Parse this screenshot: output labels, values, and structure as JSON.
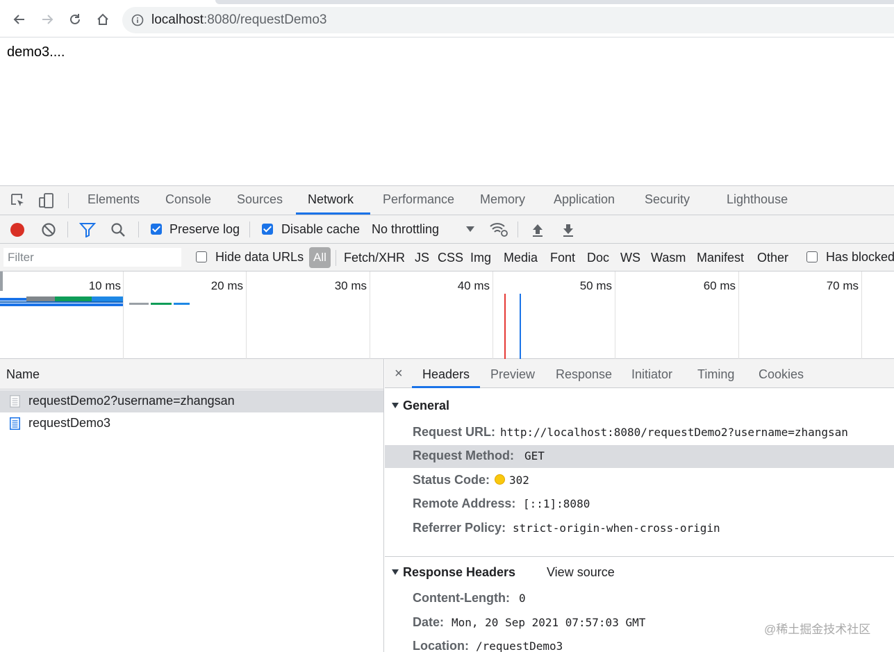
{
  "browser": {
    "url_host": "localhost",
    "url_path": ":8080/requestDemo3"
  },
  "page": {
    "body_text": "demo3...."
  },
  "devtools": {
    "tabs": [
      {
        "label": "Elements"
      },
      {
        "label": "Console"
      },
      {
        "label": "Sources"
      },
      {
        "label": "Network"
      },
      {
        "label": "Performance"
      },
      {
        "label": "Memory"
      },
      {
        "label": "Application"
      },
      {
        "label": "Security"
      },
      {
        "label": "Lighthouse"
      }
    ],
    "active_tab": "Network",
    "toolbar": {
      "preserve_log_label": "Preserve log",
      "preserve_log_checked": true,
      "disable_cache_label": "Disable cache",
      "disable_cache_checked": true,
      "throttling": "No throttling"
    },
    "filterbar": {
      "filter_placeholder": "Filter",
      "hide_data_urls_label": "Hide data URLs",
      "all_label": "All",
      "types": [
        "Fetch/XHR",
        "JS",
        "CSS",
        "Img",
        "Media",
        "Font",
        "Doc",
        "WS",
        "Wasm",
        "Manifest",
        "Other"
      ],
      "has_blocked_label": "Has blocked"
    },
    "overview": {
      "ticks": [
        "10 ms",
        "20 ms",
        "30 ms",
        "40 ms",
        "50 ms",
        "60 ms",
        "70 ms"
      ]
    },
    "requests": {
      "header": "Name",
      "items": [
        {
          "name": "requestDemo2?username=zhangsan",
          "selected": true
        },
        {
          "name": "requestDemo3",
          "selected": false
        }
      ]
    },
    "details": {
      "close_glyph": "×",
      "tabs": [
        "Headers",
        "Preview",
        "Response",
        "Initiator",
        "Timing",
        "Cookies"
      ],
      "active_tab": "Headers",
      "general": {
        "title": "General",
        "rows": [
          {
            "key": "Request URL:",
            "value": "http://localhost:8080/requestDemo2?username=zhangsan"
          },
          {
            "key": "Request Method:",
            "value": "GET"
          },
          {
            "key": "Status Code:",
            "value": "302"
          },
          {
            "key": "Remote Address:",
            "value": "[::1]:8080"
          },
          {
            "key": "Referrer Policy:",
            "value": "strict-origin-when-cross-origin"
          }
        ]
      },
      "response_headers": {
        "title": "Response Headers",
        "view_source": "View source",
        "rows": [
          {
            "key": "Content-Length:",
            "value": "0"
          },
          {
            "key": "Date:",
            "value": "Mon, 20 Sep 2021 07:57:03 GMT"
          },
          {
            "key": "Location:",
            "value": "/requestDemo3"
          }
        ]
      }
    }
  },
  "watermark": "@稀土掘金技术社区",
  "colors": {
    "accent": "#1a73e8",
    "record_red": "#d93025",
    "status_yellow": "#f9c80e",
    "load_line": "#e53935",
    "domcontent_line": "#1a73e8"
  }
}
